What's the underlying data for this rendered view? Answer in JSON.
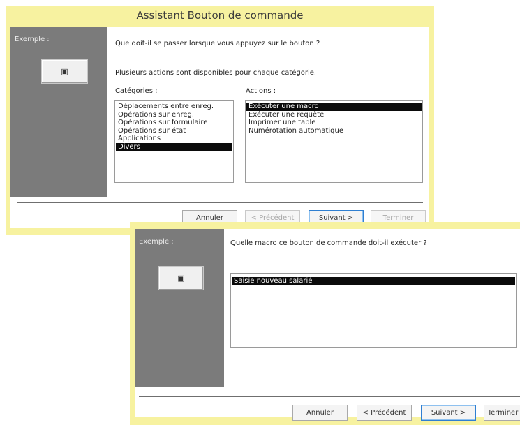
{
  "dialog1": {
    "title": "Assistant Bouton de commande",
    "example_label": "Exemple :",
    "sample_button_glyph": "▣",
    "question": "Que doit-il se passer lorsque vous appuyez sur le bouton ?",
    "info": "Plusieurs actions sont disponibles pour chaque catégorie.",
    "categories_label": "Catégories :",
    "actions_label": "Actions :",
    "categories": [
      "Déplacements entre enreg.",
      "Opérations sur enreg.",
      "Opérations sur formulaire",
      "Opérations sur état",
      "Applications",
      "Divers"
    ],
    "categories_selected": "Divers",
    "actions": [
      "Exécuter une macro",
      "Exécuter une requête",
      "Imprimer une table",
      "Numérotation automatique"
    ],
    "actions_selected": "Exécuter une macro",
    "buttons": {
      "cancel": "Annuler",
      "previous": "< Précédent",
      "next": "Suivant >",
      "finish": "Terminer"
    }
  },
  "dialog2": {
    "example_label": "Exemple :",
    "sample_button_glyph": "▣",
    "question": "Quelle macro ce bouton de commande doit-il exécuter ?",
    "macros": [
      "Saisie nouveau salarié"
    ],
    "macros_selected": "Saisie nouveau salarié",
    "buttons": {
      "cancel": "Annuler",
      "previous": "< Précédent",
      "next": "Suivant >",
      "finish": "Terminer"
    }
  },
  "colors": {
    "window_frame": "#f7f2a0",
    "example_panel": "#7b7b7b",
    "selection": "#0b0b0b",
    "default_button_border": "#2f7fd1"
  }
}
